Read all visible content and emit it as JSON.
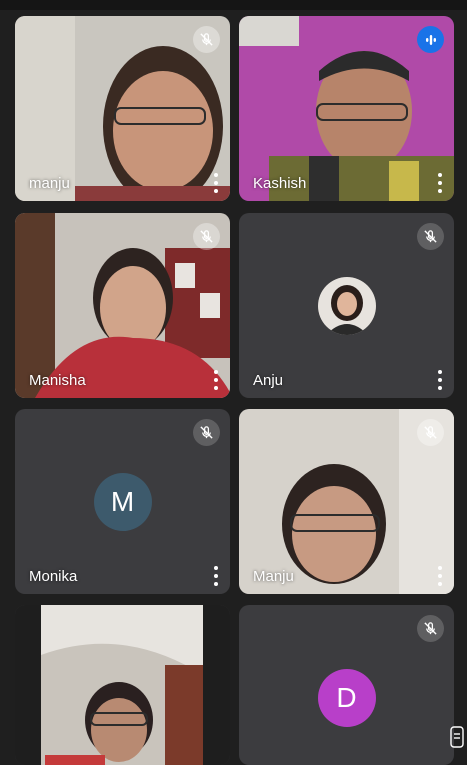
{
  "participants": [
    {
      "name": "manju",
      "mic": "muted",
      "type": "video"
    },
    {
      "name": "Kashish",
      "mic": "speaking",
      "type": "video"
    },
    {
      "name": "Manisha",
      "mic": "muted",
      "type": "video"
    },
    {
      "name": "Anju",
      "mic": "muted",
      "type": "photo-avatar"
    },
    {
      "name": "Monika",
      "mic": "muted",
      "type": "letter-avatar",
      "initial": "M",
      "avatar_color": "#3d5a6c"
    },
    {
      "name": "Manju",
      "mic": "muted",
      "type": "video"
    },
    {
      "name": "",
      "mic": "none",
      "type": "video"
    },
    {
      "name": "",
      "mic": "muted",
      "type": "letter-avatar",
      "initial": "D",
      "avatar_color": "#b83fc9"
    }
  ],
  "colors": {
    "background": "#1f1f1f",
    "tile": "#3c3c3f",
    "speaking": "#1a73e8"
  }
}
